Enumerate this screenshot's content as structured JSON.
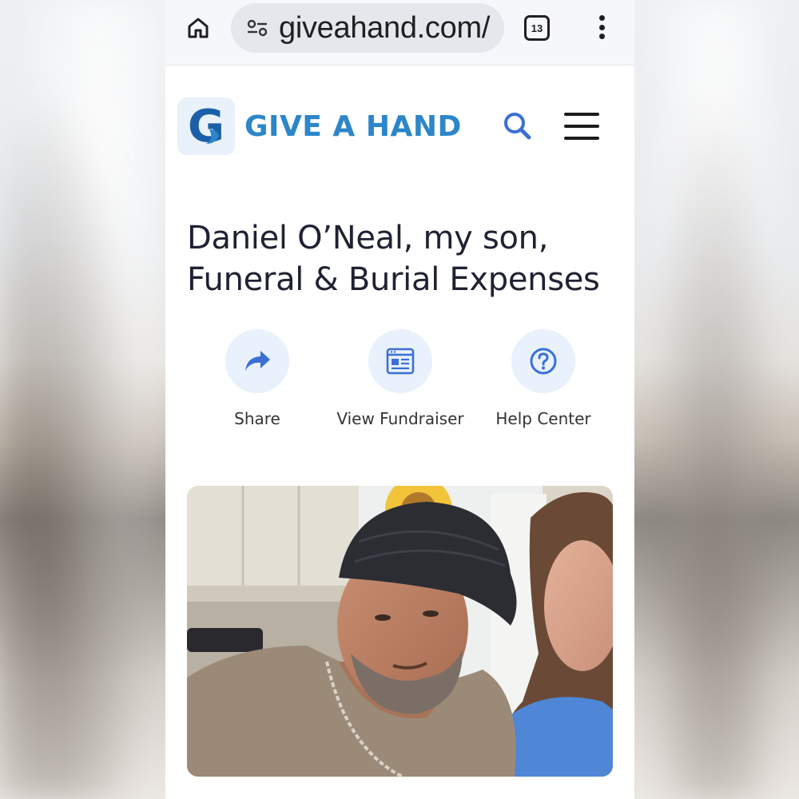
{
  "browser": {
    "url": "giveahand.com/",
    "tab_count": "13"
  },
  "header": {
    "logo_letter": "G",
    "logo_text": "GIVE A HAND"
  },
  "fundraiser": {
    "title": "Daniel O’Neal, my son, Funeral & Burial Expenses"
  },
  "actions": [
    {
      "label": "Share",
      "icon": "share-icon"
    },
    {
      "label": "View Fundraiser",
      "icon": "browser-window-icon"
    },
    {
      "label": "Help Center",
      "icon": "question-icon"
    }
  ],
  "colors": {
    "brand_blue": "#2c86c9",
    "brand_dark_blue": "#1a5fa8",
    "icon_blue": "#3b6fd8",
    "action_bg": "#e8f1fc",
    "title_text": "#1f2233"
  }
}
